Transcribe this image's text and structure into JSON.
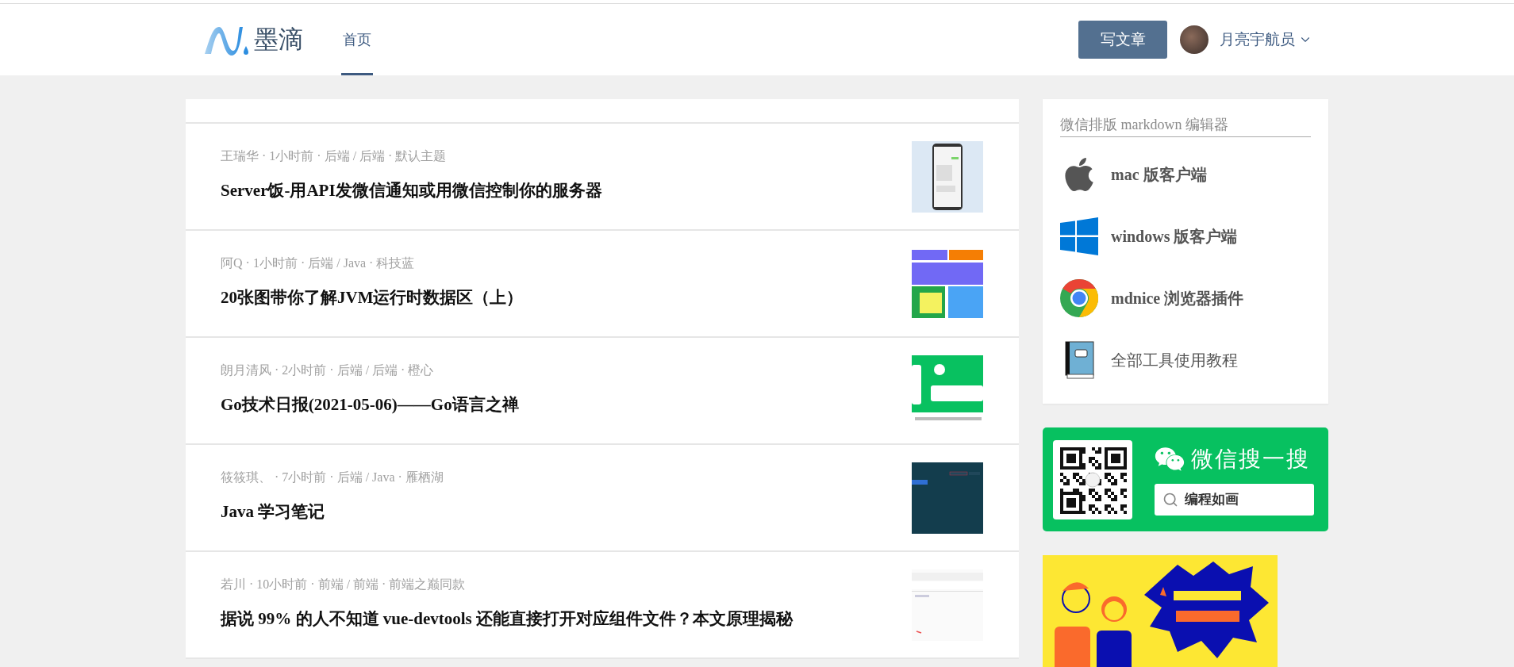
{
  "header": {
    "logo": "墨滴",
    "nav": [
      {
        "label": "首页",
        "selected": true
      }
    ],
    "write_button": "写文章",
    "user": "月亮宇航员"
  },
  "articles": [
    {
      "meta": "王瑞华 · 1小时前 · 后端 / 后端 · 默认主题",
      "title": "Server饭-用API发微信通知或用微信控制你的服务器"
    },
    {
      "meta": "阿Q · 1小时前 · 后端 / Java · 科技蓝",
      "title": "20张图带你了解JVM运行时数据区（上）"
    },
    {
      "meta": "朗月清风 · 2小时前 · 后端 / 后端 · 橙心",
      "title": "Go技术日报(2021-05-06)——Go语言之禅"
    },
    {
      "meta": "筱筱琪、 · 7小时前 · 后端 / Java · 雁栖湖",
      "title": "Java 学习笔记"
    },
    {
      "meta": "若川 · 10小时前 · 前端 / 前端 · 前端之巅同款",
      "title": "据说 99% 的人不知道 vue-devtools 还能直接打开对应组件文件？本文原理揭秘"
    }
  ],
  "sidebar": {
    "tools_title": "微信排版 markdown 编辑器",
    "tools": [
      {
        "kind": "apple",
        "label": "mac 版客户端"
      },
      {
        "kind": "windows",
        "label": "windows 版客户端"
      },
      {
        "kind": "chrome",
        "label": "mdnice 浏览器插件"
      },
      {
        "kind": "book",
        "label": "全部工具使用教程"
      }
    ],
    "wechat_search": {
      "title": "微信搜一搜",
      "query": "编程如画"
    }
  }
}
